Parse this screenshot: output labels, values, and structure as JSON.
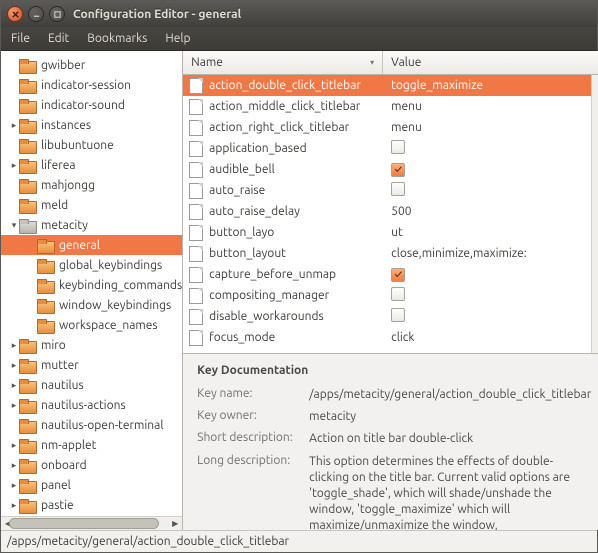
{
  "window": {
    "title": "Configuration Editor - general"
  },
  "menu": {
    "file": "File",
    "edit": "Edit",
    "bookmarks": "Bookmarks",
    "help": "Help"
  },
  "tree": [
    {
      "label": "gwibber",
      "depth": 1,
      "sel": false,
      "exp": ""
    },
    {
      "label": "indicator-session",
      "depth": 1,
      "sel": false,
      "exp": ""
    },
    {
      "label": "indicator-sound",
      "depth": 1,
      "sel": false,
      "exp": ""
    },
    {
      "label": "instances",
      "depth": 1,
      "sel": false,
      "exp": "▸"
    },
    {
      "label": "libubuntuone",
      "depth": 1,
      "sel": false,
      "exp": ""
    },
    {
      "label": "liferea",
      "depth": 1,
      "sel": false,
      "exp": "▸"
    },
    {
      "label": "mahjongg",
      "depth": 1,
      "sel": false,
      "exp": ""
    },
    {
      "label": "meld",
      "depth": 1,
      "sel": false,
      "exp": ""
    },
    {
      "label": "metacity",
      "depth": 1,
      "sel": false,
      "exp": "▾",
      "grey": true
    },
    {
      "label": "general",
      "depth": 2,
      "sel": true,
      "exp": ""
    },
    {
      "label": "global_keybindings",
      "depth": 2,
      "sel": false,
      "exp": ""
    },
    {
      "label": "keybinding_commands",
      "depth": 2,
      "sel": false,
      "exp": ""
    },
    {
      "label": "window_keybindings",
      "depth": 2,
      "sel": false,
      "exp": ""
    },
    {
      "label": "workspace_names",
      "depth": 2,
      "sel": false,
      "exp": ""
    },
    {
      "label": "miro",
      "depth": 1,
      "sel": false,
      "exp": "▸"
    },
    {
      "label": "mutter",
      "depth": 1,
      "sel": false,
      "exp": "▸"
    },
    {
      "label": "nautilus",
      "depth": 1,
      "sel": false,
      "exp": "▸"
    },
    {
      "label": "nautilus-actions",
      "depth": 1,
      "sel": false,
      "exp": "▸"
    },
    {
      "label": "nautilus-open-terminal",
      "depth": 1,
      "sel": false,
      "exp": ""
    },
    {
      "label": "nm-applet",
      "depth": 1,
      "sel": false,
      "exp": "▸"
    },
    {
      "label": "onboard",
      "depth": 1,
      "sel": false,
      "exp": "▸"
    },
    {
      "label": "panel",
      "depth": 1,
      "sel": false,
      "exp": "▸"
    },
    {
      "label": "pastie",
      "depth": 1,
      "sel": false,
      "exp": "▸"
    }
  ],
  "table": {
    "headers": {
      "name": "Name",
      "value": "Value"
    },
    "rows": [
      {
        "name": "action_double_click_titlebar",
        "value": "toggle_maximize",
        "type": "text",
        "sel": true
      },
      {
        "name": "action_middle_click_titlebar",
        "value": "menu",
        "type": "text"
      },
      {
        "name": "action_right_click_titlebar",
        "value": "menu",
        "type": "text"
      },
      {
        "name": "application_based",
        "type": "check",
        "checked": false
      },
      {
        "name": "audible_bell",
        "type": "check",
        "checked": true
      },
      {
        "name": "auto_raise",
        "type": "check",
        "checked": false
      },
      {
        "name": "auto_raise_delay",
        "value": "500",
        "type": "text"
      },
      {
        "name": "button_layo",
        "value": "ut",
        "type": "text"
      },
      {
        "name": "button_layout",
        "value": "close,minimize,maximize:",
        "type": "text"
      },
      {
        "name": "capture_before_unmap",
        "type": "check",
        "checked": true
      },
      {
        "name": "compositing_manager",
        "type": "check",
        "checked": false
      },
      {
        "name": "disable_workarounds",
        "type": "check",
        "checked": false
      },
      {
        "name": "focus_mode",
        "value": "click",
        "type": "text"
      }
    ]
  },
  "doc": {
    "heading": "Key Documentation",
    "labels": {
      "key_name": "Key name:",
      "key_owner": "Key owner:",
      "short": "Short description:",
      "long": "Long description:"
    },
    "key_name": "/apps/metacity/general/action_double_click_titlebar",
    "key_owner": "metacity",
    "short": "Action on title bar double-click",
    "long": "This option determines the effects of double-clicking on the title bar. Current valid options are 'toggle_shade', which will shade/unshade the window, 'toggle_maximize' which will maximize/unmaximize the window,"
  },
  "statusbar": "/apps/metacity/general/action_double_click_titlebar"
}
